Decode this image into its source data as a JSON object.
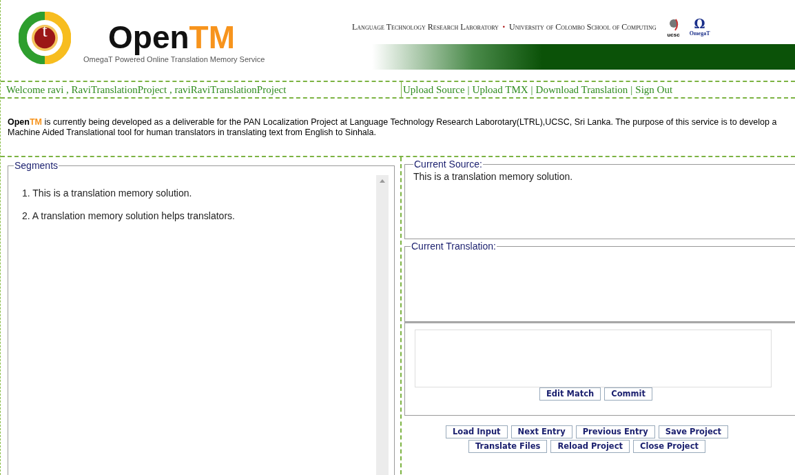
{
  "header": {
    "logo_open": "Open",
    "logo_tm": "TM",
    "logo_letter": "t",
    "tagline": "OmegaT Powered Online Translation Memory Service",
    "lab": "Language Technology Research Laboratory",
    "dot": "•",
    "university": "University of Colombo School of Computing",
    "ucsc_label": "ucsc",
    "omega_symbol": "Ω",
    "omega_label": "OmegaT"
  },
  "welcome": "Welcome ravi , RaviTranslationProject , raviRaviTranslationProject",
  "nav_links": [
    "Upload Source",
    "Upload TMX",
    "Download Translation",
    "Sign Out"
  ],
  "nav_separator": "|",
  "intro": {
    "brand_a": "Open",
    "brand_b": "TM",
    "text": " is currently being developed as a deliverable for the PAN Localization Project at Language Technology Research Laborotary(LTRL),UCSC, Sri Lanka. The purpose of this service is to develop a Machine Aided Translational tool for human translators in translating text from English to Sinhala."
  },
  "segments": {
    "legend": "Segments",
    "items": [
      {
        "number": "1.",
        "text": "This is a translation memory solution."
      },
      {
        "number": "2.",
        "text": "A translation memory solution helps translators."
      }
    ]
  },
  "current_source": {
    "legend": "Current Source:",
    "text": "This is a translation memory solution."
  },
  "current_translation": {
    "legend": "Current Translation:"
  },
  "match_buttons": [
    "Edit Match",
    "Commit"
  ],
  "action_rows": [
    [
      "Load Input",
      "Next Entry",
      "Previous Entry",
      "Save Project"
    ],
    [
      "Translate Files",
      "Reload Project",
      "Close Project"
    ]
  ]
}
